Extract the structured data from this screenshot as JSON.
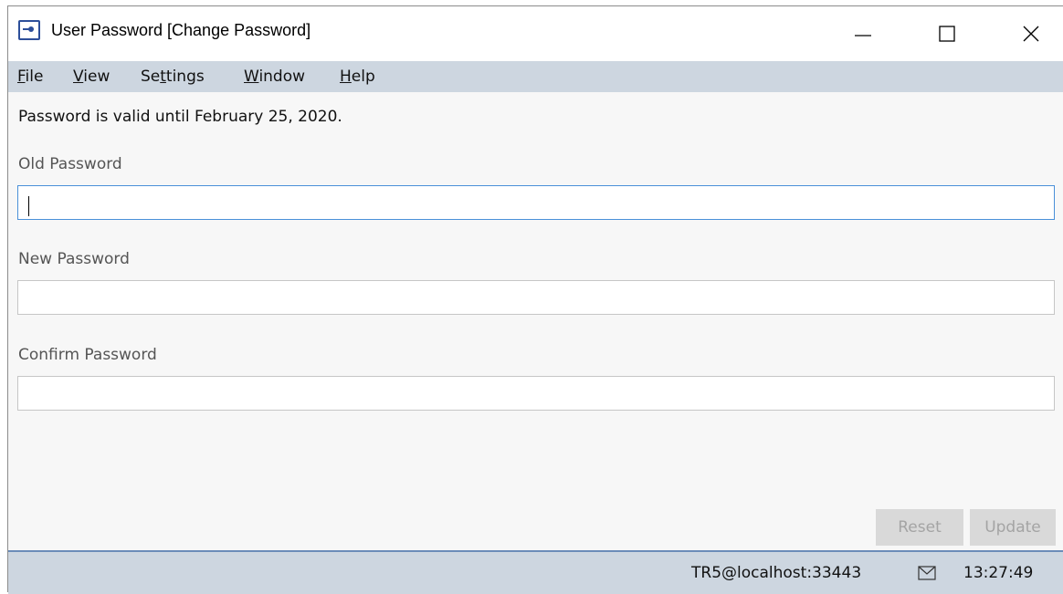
{
  "window": {
    "title": "User Password [Change Password]",
    "icon": "key-icon"
  },
  "window_controls": {
    "minimize": "minimize-icon",
    "maximize": "maximize-icon",
    "close": "close-icon"
  },
  "menu": {
    "items": [
      {
        "mnemonic": "F",
        "rest": "ile"
      },
      {
        "mnemonic": "V",
        "rest": "iew"
      },
      {
        "pre": "Se",
        "mnemonic": "t",
        "rest": "tings"
      },
      {
        "mnemonic": "W",
        "rest": "indow"
      },
      {
        "mnemonic": "H",
        "rest": "elp"
      }
    ]
  },
  "validity_message": "Password is valid until February 25, 2020.",
  "form": {
    "old_password": {
      "label": "Old Password",
      "value": ""
    },
    "new_password": {
      "label": "New Password",
      "value": ""
    },
    "confirm_password": {
      "label": "Confirm Password",
      "value": ""
    }
  },
  "buttons": {
    "reset": "Reset",
    "update": "Update"
  },
  "status": {
    "connection": "TR5@localhost:33443",
    "mail_icon": "mail-icon",
    "time": "13:27:49"
  },
  "colors": {
    "menubar_bg": "#cdd6e0",
    "statusbar_border": "#6b8cb8",
    "focus_border": "#4a90d9",
    "disabled_button_bg": "#d9d9d9",
    "disabled_button_text": "#a4a4a4",
    "app_icon": "#2d4f9a"
  }
}
